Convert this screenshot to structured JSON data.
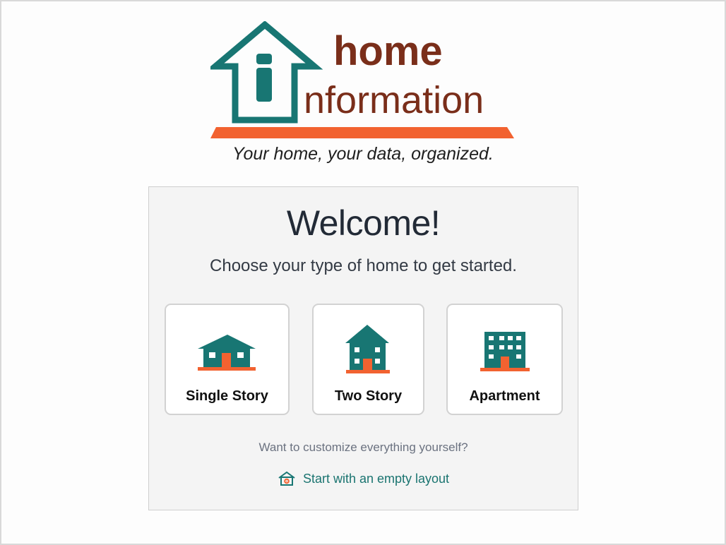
{
  "logo": {
    "word_top": "home",
    "word_bottom": "nformation",
    "colors": {
      "teal": "#187673",
      "brown": "#7a2e1a",
      "orange": "#f26230"
    }
  },
  "tagline": "Your home, your data, organized.",
  "welcome": {
    "title": "Welcome!",
    "subtitle": "Choose your type of home to get started."
  },
  "home_types": [
    {
      "label": "Single Story",
      "icon": "single-story-house-icon"
    },
    {
      "label": "Two Story",
      "icon": "two-story-house-icon"
    },
    {
      "label": "Apartment",
      "icon": "apartment-building-icon"
    }
  ],
  "customize": {
    "question": "Want to customize everything yourself?",
    "link_label": "Start with an empty layout",
    "link_icon": "house-gear-icon"
  }
}
